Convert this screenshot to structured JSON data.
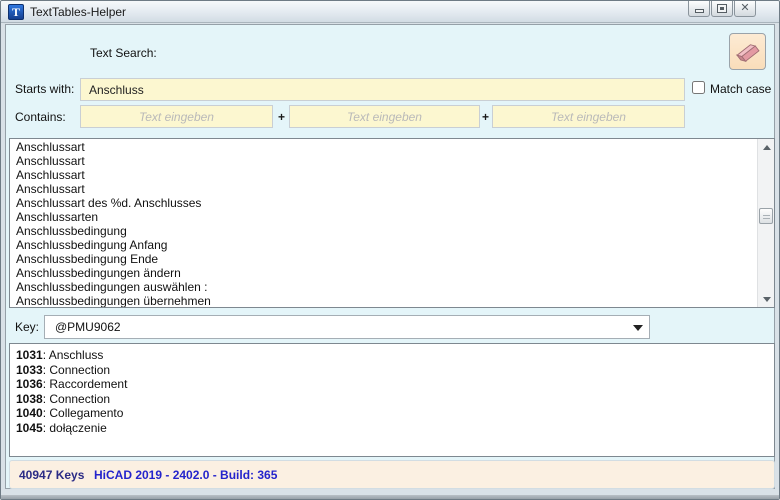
{
  "window": {
    "title": "TextTables-Helper",
    "icon_letter": "T"
  },
  "search": {
    "section_label": "Text Search:",
    "starts_with_label": "Starts with:",
    "starts_with_value": "Anschluss",
    "match_case_label": "Match case",
    "contains_label": "Contains:",
    "contains_placeholder": "Text eingeben",
    "plus_separator": "+"
  },
  "main_list": {
    "items": [
      "Anschlussart",
      "Anschlussart",
      "Anschlussart",
      "Anschlussart",
      "Anschlussart des %d. Anschlusses",
      "Anschlussarten",
      "Anschlussbedingung",
      "Anschlussbedingung Anfang",
      "Anschlussbedingung Ende",
      "Anschlussbedingungen ändern",
      "Anschlussbedingungen auswählen :",
      "Anschlussbedingungen übernehmen"
    ]
  },
  "key_section": {
    "label": "Key:",
    "value": "@PMU9062"
  },
  "translations": {
    "items": [
      {
        "id": "1031",
        "text": "Anschluss"
      },
      {
        "id": "1033",
        "text": "Connection"
      },
      {
        "id": "1036",
        "text": "Raccordement"
      },
      {
        "id": "1038",
        "text": "Connection"
      },
      {
        "id": "1040",
        "text": "Collegamento"
      },
      {
        "id": "1045",
        "text": "dołączenie"
      }
    ]
  },
  "status": {
    "keys_label": "40947 Keys",
    "version_label": "HiCAD 2019 - 2402.0 - Build: 365"
  },
  "colors": {
    "panel_background": "#e4f5f9",
    "input_background": "#fcf7d0",
    "status_background": "#fbf0e2",
    "status_text_blue": "#2424cc",
    "status_keys_navy": "#2b2b85",
    "eraser_pink": "#e8a2aa"
  }
}
